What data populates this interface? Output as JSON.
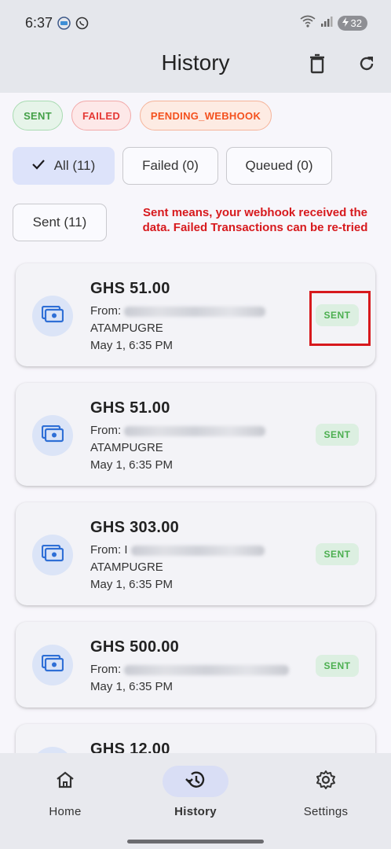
{
  "status_bar": {
    "time": "6:37",
    "battery": "32"
  },
  "app_bar": {
    "title": "History"
  },
  "legend": {
    "sent": "SENT",
    "failed": "FAILED",
    "pending": "PENDING_WEBHOOK"
  },
  "filters": {
    "all": "All (11)",
    "failed": "Failed (0)",
    "queued": "Queued (0)",
    "sent": "Sent (11)"
  },
  "note": "Sent means, your webhook received the data. Failed Transactions can be re-tried",
  "transactions": [
    {
      "amount": "GHS 51.00",
      "from_label": "From:",
      "name_line2": "ATAMPUGRE",
      "time": "May 1, 6:35 PM",
      "status": "SENT"
    },
    {
      "amount": "GHS 51.00",
      "from_label": "From:",
      "name_line2": "ATAMPUGRE",
      "time": "May 1, 6:35 PM",
      "status": "SENT"
    },
    {
      "amount": "GHS 303.00",
      "from_label": "From: I",
      "name_line2": "ATAMPUGRE",
      "time": "May 1, 6:35 PM",
      "status": "SENT"
    },
    {
      "amount": "GHS 500.00",
      "from_label": "From:",
      "name_line2": "",
      "time": "May 1, 6:35 PM",
      "status": "SENT"
    },
    {
      "amount": "GHS 12.00"
    }
  ],
  "bottom_nav": {
    "home": "Home",
    "history": "History",
    "settings": "Settings"
  },
  "colors": {
    "sent": "#4caf50",
    "failed": "#e53935",
    "pending": "#f4511e",
    "accent": "#d9def5"
  }
}
